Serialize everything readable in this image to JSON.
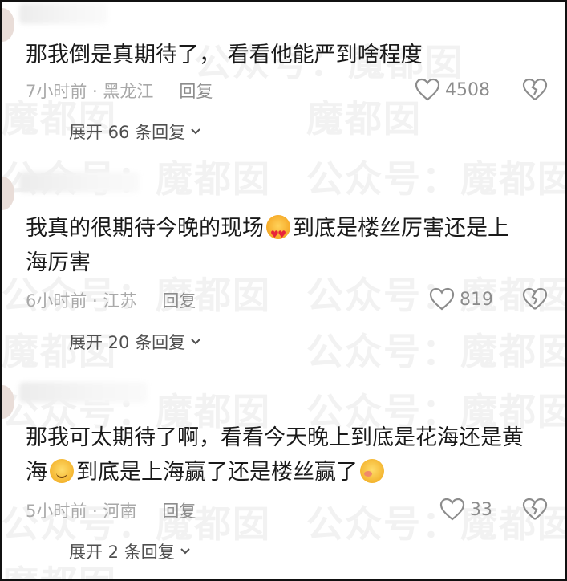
{
  "watermark": "魔都囡",
  "watermark_full": "公众号：魔都囡",
  "comments": [
    {
      "text": "那我倒是真期待了， 看看他能严到啥程度",
      "time_location": "7小时前 · 黑龙江",
      "reply_label": "回复",
      "likes": "4508",
      "expand_label": "展开 66 条回复"
    },
    {
      "text_line1_a": "我真的很期待今晚的现场",
      "text_line1_b": "到底是楼丝厉害还是上",
      "text_line2": "海厉害",
      "emoji": "heart-eyes-emoji",
      "time_location": "6小时前 · 江苏",
      "reply_label": "回复",
      "likes": "819",
      "expand_label": "展开 20 条回复"
    },
    {
      "text_line1": "那我可太期待了啊，看看今天晚上到底是花海还是黄",
      "text_line2_a": "海",
      "text_line2_b": "到底是上海赢了还是楼丝赢了",
      "emojis": [
        "smile-emoji",
        "shy-emoji"
      ],
      "time_location": "5小时前 · 河南",
      "reply_label": "回复",
      "likes": "33",
      "expand_label": "展开 2 条回复"
    }
  ],
  "colors": {
    "text": "#1a1a1a",
    "meta": "#a3a3a3",
    "reply": "#8c8c8c",
    "expand": "#4f4f4f",
    "border": "#111111"
  }
}
